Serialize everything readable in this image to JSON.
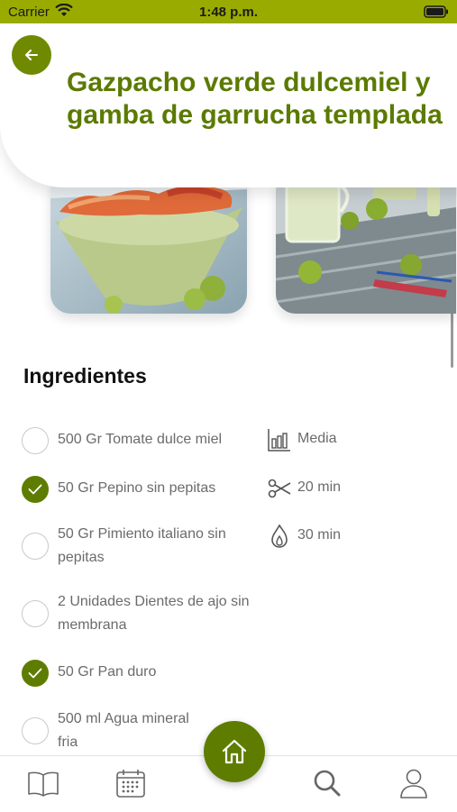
{
  "status_bar": {
    "carrier": "Carrier",
    "time": "1:48 p.m."
  },
  "header": {
    "title": "Gazpacho verde dulcemiel y gamba de garrucha templada"
  },
  "ingredients_section": {
    "title": "Ingredientes",
    "items": [
      {
        "text": "500 Gr Tomate dulce miel",
        "checked": false
      },
      {
        "text": "50 Gr Pepino sin pepitas",
        "checked": true
      },
      {
        "text": "50 Gr Pimiento italiano sin pepitas",
        "checked": false
      },
      {
        "text": "2 Unidades Dientes de ajo sin membrana",
        "checked": false
      },
      {
        "text": "50 Gr Pan duro",
        "checked": true
      },
      {
        "text": "500 ml Agua mineral fria",
        "checked": false
      }
    ]
  },
  "meta": {
    "difficulty": {
      "icon": "difficulty-bars-icon",
      "text": "Media"
    },
    "prep_time": {
      "icon": "scissors-icon",
      "text": "20 min"
    },
    "cook_time": {
      "icon": "flame-icon",
      "text": "30 min"
    }
  },
  "bottom_nav": {
    "items": [
      "book-icon",
      "calendar-icon",
      "home-icon",
      "search-icon",
      "user-icon"
    ]
  },
  "colors": {
    "accent": "#5e7d00",
    "status_bar": "#9aab00",
    "title": "#5b7a00"
  }
}
